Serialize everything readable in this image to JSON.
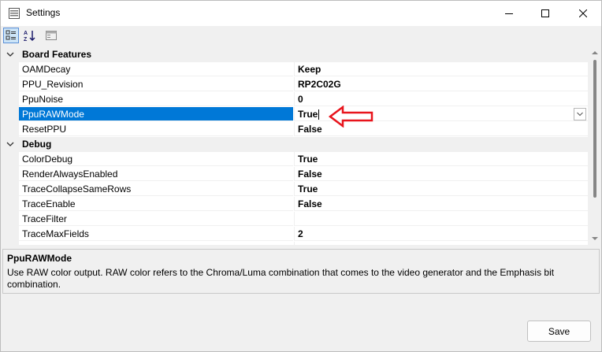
{
  "window": {
    "title": "Settings"
  },
  "toolbar": {
    "categorized_active": true
  },
  "grid": {
    "categories": [
      {
        "name": "Board Features",
        "properties": [
          {
            "name": "OAMDecay",
            "value": "Keep"
          },
          {
            "name": "PPU_Revision",
            "value": "RP2C02G"
          },
          {
            "name": "PpuNoise",
            "value": "0"
          },
          {
            "name": "PpuRAWMode",
            "value": "True"
          },
          {
            "name": "ResetPPU",
            "value": "False"
          }
        ]
      },
      {
        "name": "Debug",
        "properties": [
          {
            "name": "ColorDebug",
            "value": "True"
          },
          {
            "name": "RenderAlwaysEnabled",
            "value": "False"
          },
          {
            "name": "TraceCollapseSameRows",
            "value": "True"
          },
          {
            "name": "TraceEnable",
            "value": "False"
          },
          {
            "name": "TraceFilter",
            "value": ""
          },
          {
            "name": "TraceMaxFields",
            "value": "2"
          }
        ]
      }
    ],
    "selected": "PpuRAWMode"
  },
  "help": {
    "title": "PpuRAWMode",
    "description": "Use RAW color output. RAW color refers to the Chroma/Luma combination that comes to the video generator and the Emphasis bit combination."
  },
  "footer": {
    "save_label": "Save"
  },
  "colors": {
    "selection": "#0078d7",
    "annotation_arrow": "#e8141c"
  }
}
